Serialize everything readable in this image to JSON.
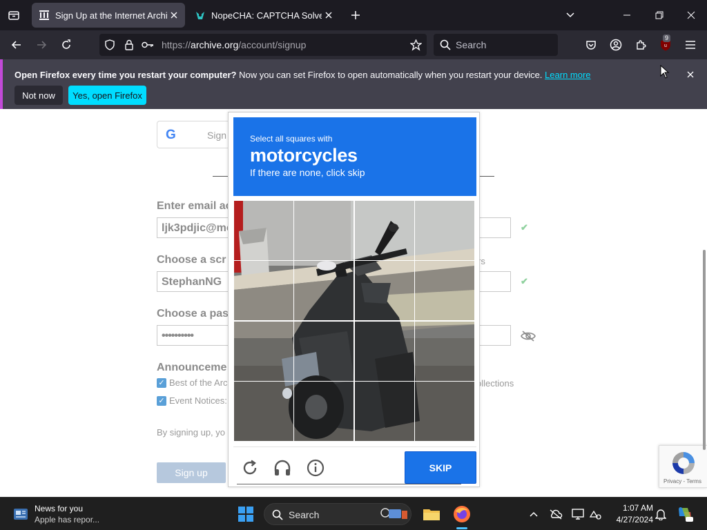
{
  "browser": {
    "tabs": [
      {
        "title": "Sign Up at the Internet Archive",
        "active": true
      },
      {
        "title": "NopeCHA: CAPTCHA Solver – C",
        "active": false
      }
    ],
    "url_prefix": "https://",
    "url_host": "archive.org",
    "url_path": "/account/signup",
    "search_placeholder": "Search",
    "extension_badge": "9"
  },
  "notification": {
    "bold_text": "Open Firefox every time you restart your computer?",
    "text": " Now you can set Firefox to open automatically when you restart your device. ",
    "link": "Learn more",
    "not_now": "Not now",
    "yes": "Yes, open Firefox"
  },
  "page": {
    "google_button": "Sign",
    "email_label": "Enter email ac",
    "email_value": "ljk3pdjic@mc",
    "screen_label": "Choose a scr",
    "screen_value": "StephanNG",
    "screen_hint": "rs",
    "password_label": "Choose a pas",
    "password_value": "••••••••••",
    "announcements_label": "Announceme",
    "checkbox1": "Best of the Arc",
    "checkbox1_tail": "ollections",
    "checkbox2": "Event Notices:",
    "terms": "By signing up, yo",
    "signup_button": "Sign up",
    "recaptcha_terms": "Privacy - Terms"
  },
  "captcha": {
    "line1": "Select all squares with",
    "target": "motorcycles",
    "line3": "If there are none, click skip",
    "skip": "SKIP",
    "colors": {
      "header": "#1a73e8"
    }
  },
  "taskbar": {
    "news_title": "News for you",
    "news_sub": "Apple has repor...",
    "search": "Search",
    "time": "1:07 AM",
    "date": "4/27/2024"
  }
}
